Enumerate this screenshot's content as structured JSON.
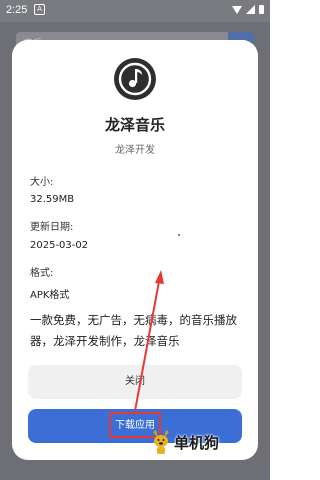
{
  "status_bar": {
    "time": "2:25",
    "notification_letter": "A"
  },
  "background": {
    "search_text": "音乐"
  },
  "dialog": {
    "app_name": "龙泽音乐",
    "developer": "龙泽开发",
    "size_label": "大小:",
    "size_value": "32.59MB",
    "date_label": "更新日期:",
    "date_value": "2025-03-02",
    "format_label": "格式:",
    "format_value": "APK格式",
    "description": "一款免费，无广告，无病毒，的音乐播放器，龙泽开发制作，龙泽音乐",
    "close_label": "关闭",
    "download_label": "下载应用"
  },
  "watermark": {
    "text": "单机狗"
  },
  "colors": {
    "primary": "#3c6fd6",
    "annotation_red": "#e53935",
    "overlay": "#6e6f74"
  }
}
